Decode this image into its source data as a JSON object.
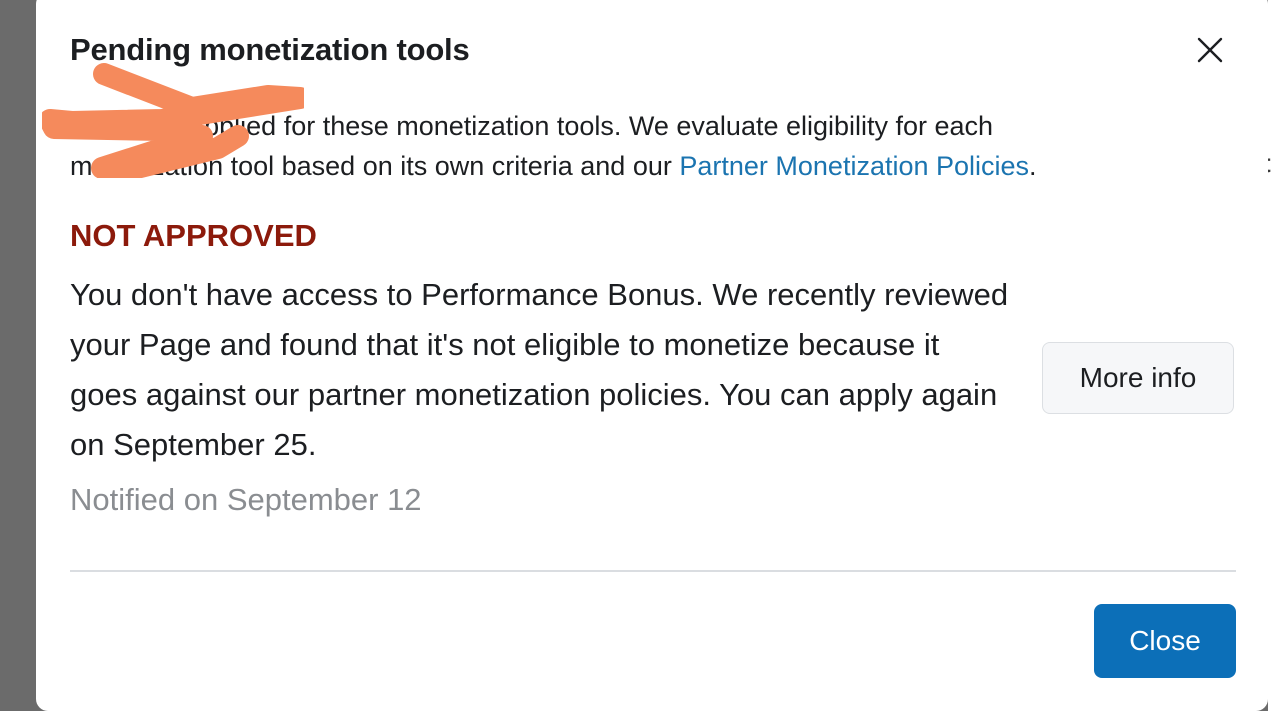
{
  "dialog": {
    "title": "Pending monetization tools",
    "intro_text": "You have applied for these monetization tools. We evaluate eligibility for each monetization tool based on its own criteria and our ",
    "intro_link": "Partner Monetization Policies",
    "intro_end": ".",
    "status_label": "NOT APPROVED",
    "message": "You don't have access to Performance Bonus. We recently reviewed your Page and found that it's not eligible to monetize because it goes against our partner monetization policies. You can apply again on September 25.",
    "notified": "Notified on September 12",
    "more_info_label": "More info",
    "close_label": "Close"
  },
  "background_fragment": "t",
  "colors": {
    "status_red": "#8c1a0b",
    "link_blue": "#1b74b0",
    "primary_button": "#0c6fb8",
    "scribble_orange": "#f58a5c"
  },
  "icons": {
    "close": "close-icon"
  }
}
